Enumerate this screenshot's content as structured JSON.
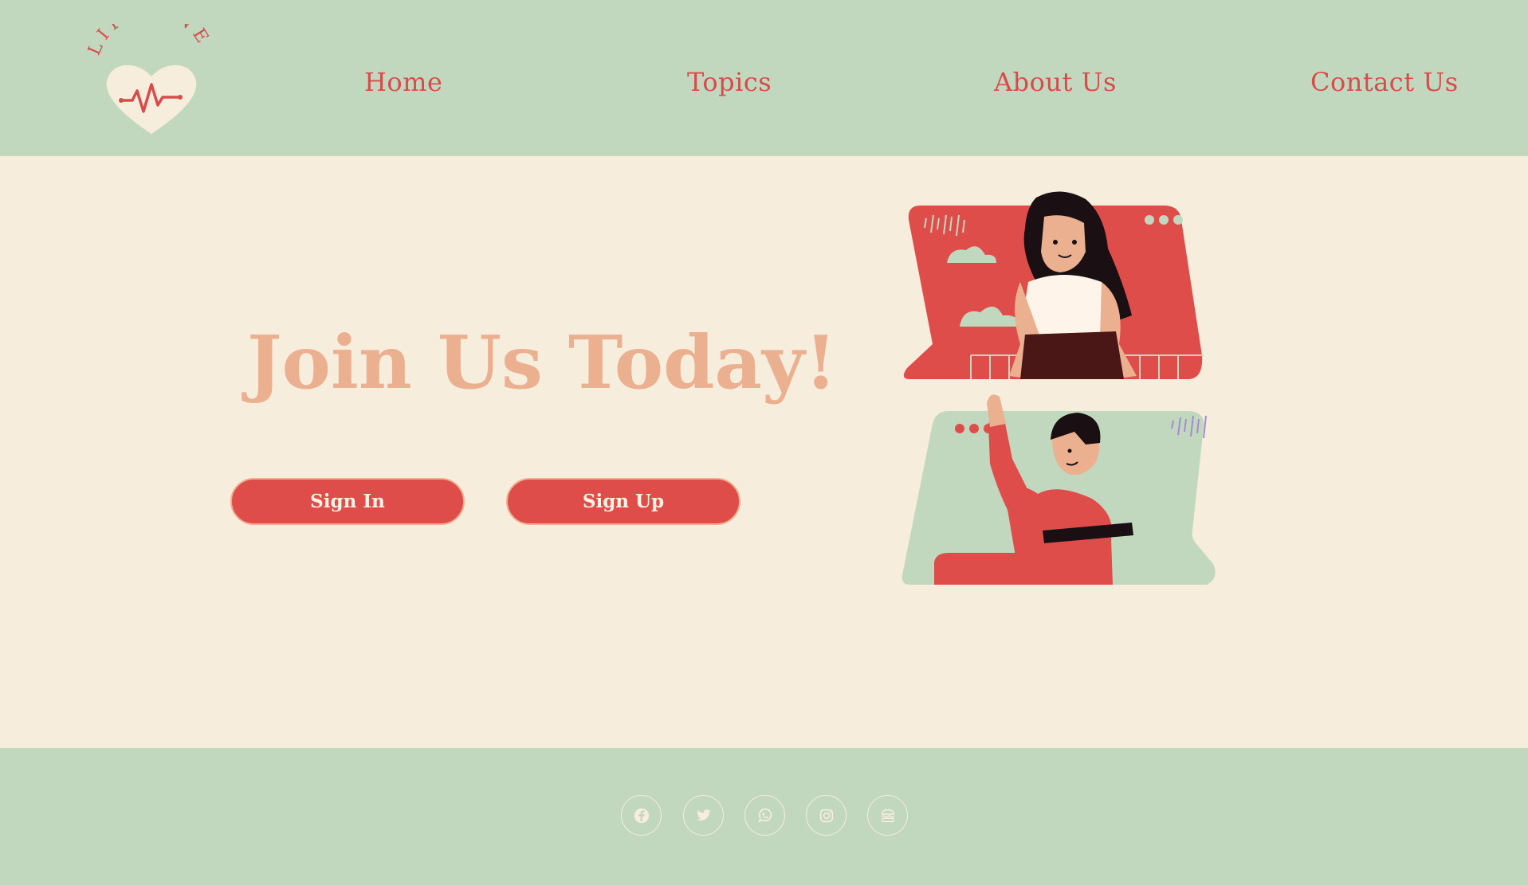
{
  "brand": {
    "name": "LIFELINE",
    "colors": {
      "red": "#df4d4b",
      "mint": "#c1d8bf",
      "cream": "#f6eddd",
      "peach": "#ebb08f"
    }
  },
  "nav": {
    "items": [
      {
        "label": "Home"
      },
      {
        "label": "Topics"
      },
      {
        "label": "About Us"
      },
      {
        "label": "Contact Us"
      }
    ]
  },
  "hero": {
    "title": "Join Us Today!",
    "sign_in_label": "Sign In",
    "sign_up_label": "Sign Up"
  },
  "footer": {
    "social": [
      {
        "icon": "facebook-icon"
      },
      {
        "icon": "twitter-icon"
      },
      {
        "icon": "whatsapp-icon"
      },
      {
        "icon": "instagram-icon"
      },
      {
        "icon": "burger-icon"
      }
    ]
  }
}
